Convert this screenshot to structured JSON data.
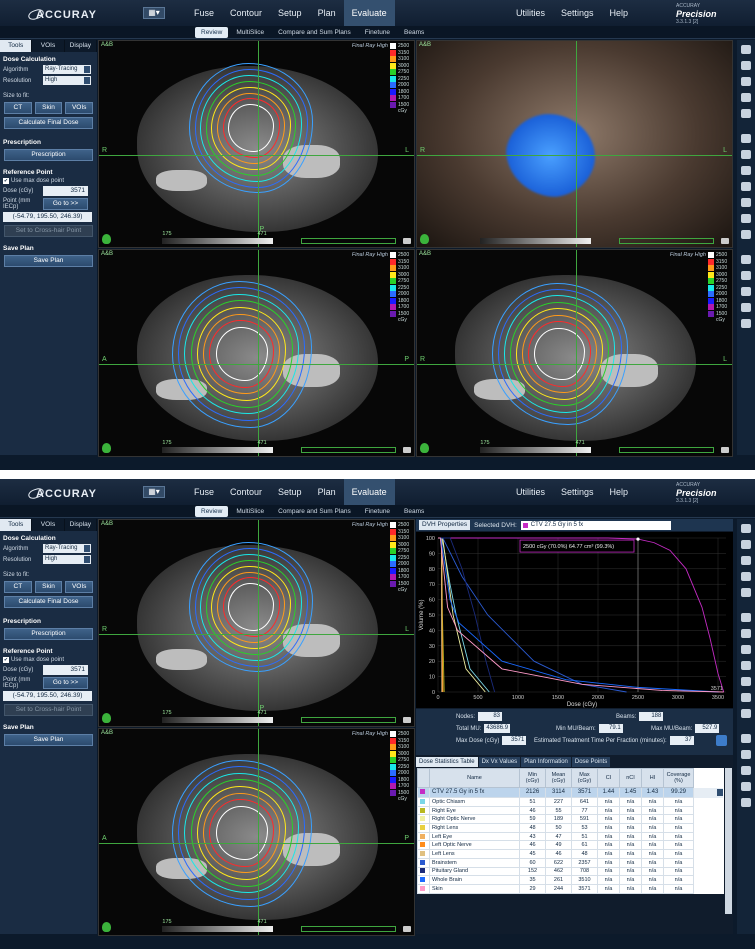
{
  "panels": [
    {
      "label": "A"
    },
    {
      "label": "B"
    }
  ],
  "app": {
    "logo": "ACCURAY",
    "brand_small": "ACCURAY",
    "brand": "Precision",
    "version": "3.3.1.3 [2]",
    "menu": [
      "Fuse",
      "Contour",
      "Setup",
      "Plan",
      "Evaluate"
    ],
    "menu_active": "Evaluate",
    "right_menu": [
      "Utilities",
      "Settings",
      "Help"
    ],
    "subtabs": [
      "Review",
      "MultiSlice",
      "Compare and Sum Plans",
      "Finetune",
      "Beams"
    ]
  },
  "sidebar": {
    "tabs": [
      "Tools",
      "VOIs",
      "Display"
    ],
    "dose_calculation": "Dose Calculation",
    "algorithm_label": "Algorithm",
    "algorithm_value": "Ray-Tracing",
    "resolution_label": "Resolution",
    "resolution_value": "High",
    "size_to_fit": "Size to fit:",
    "fit_buttons": [
      "CT",
      "Skin",
      "VOIs"
    ],
    "calc_final": "Calculate Final Dose",
    "prescription_header": "Prescription",
    "prescription_button": "Prescription",
    "reference_point": "Reference Point",
    "use_max": "Use max dose point",
    "dose_label": "Dose (cGy)",
    "dose_value": "3571",
    "point_label": "Point (mm IECp)",
    "goto": "Go to >>",
    "point_value": "(-54.79, 195.50, 246.39)",
    "crosshair": "Set to Cross-hair Point",
    "save_plan_header": "Save Plan",
    "save_plan_button": "Save Plan"
  },
  "viewport": {
    "corner": "A&B",
    "algorithm": "Final Ray High",
    "scale_values": [
      "2500",
      "3150",
      "3100",
      "3000",
      "2750",
      "2250",
      "2000",
      "1800",
      "1700",
      "1500"
    ],
    "scale_colors": [
      "#ffffff",
      "#ff2a2a",
      "#ff9a1a",
      "#ffe81a",
      "#2ad12a",
      "#1ae8e8",
      "#2a6cff",
      "#1a1aff",
      "#b01ab0",
      "#6a1ab0"
    ],
    "scale_unit": "cGy",
    "orient": {
      "R": "R",
      "L": "L",
      "A": "A",
      "P": "P"
    },
    "wl_low": "175",
    "wl_high": "471",
    "slice_num": "47",
    "slice_num2": "188",
    "slice_num3": "222"
  },
  "dvh": {
    "tab": "DVH Properties",
    "selected_label": "Selected DVH:",
    "selected_value": "CTV 27.5 Gy in 5 fx",
    "tooltip": "2500 cGy (70.0%) 64.77 cm³ (99.3%)",
    "ylabel": "Volume (%)",
    "xlabel": "Dose (cGy)",
    "xticks": [
      "0",
      "500",
      "1000",
      "1500",
      "2000",
      "2500",
      "3000",
      "3500"
    ],
    "yticks": [
      "100",
      "90",
      "80",
      "70",
      "60",
      "50",
      "40",
      "30",
      "20",
      "10",
      "0"
    ],
    "max_marker": "3571"
  },
  "chart_data": {
    "type": "line",
    "xlabel": "Dose (cGy)",
    "ylabel": "Volume (%)",
    "xlim": [
      0,
      3600
    ],
    "ylim": [
      0,
      100
    ],
    "series": [
      {
        "name": "CTV 27.5 Gy in 5 fx",
        "color": "#c42bc4",
        "x": [
          0,
          2126,
          2500,
          2700,
          2900,
          3100,
          3300,
          3400,
          3500,
          3571
        ],
        "y": [
          100,
          100,
          99.3,
          97,
          92,
          80,
          55,
          35,
          12,
          0
        ]
      },
      {
        "name": "Optic Chiasm",
        "color": "#7ad6e6",
        "x": [
          0,
          51,
          150,
          227,
          400,
          641
        ],
        "y": [
          100,
          100,
          70,
          50,
          15,
          0
        ]
      },
      {
        "name": "Right Eye",
        "color": "#b8b820",
        "x": [
          0,
          46,
          55,
          77
        ],
        "y": [
          100,
          100,
          50,
          0
        ]
      },
      {
        "name": "Right Optic Nerve",
        "color": "#f0f0a0",
        "x": [
          0,
          59,
          150,
          189,
          350,
          591
        ],
        "y": [
          100,
          100,
          65,
          50,
          15,
          0
        ]
      },
      {
        "name": "Right Lens",
        "color": "#e8d040",
        "x": [
          0,
          48,
          50,
          53
        ],
        "y": [
          100,
          100,
          50,
          0
        ]
      },
      {
        "name": "Left Eye",
        "color": "#f0b060",
        "x": [
          0,
          43,
          47,
          51
        ],
        "y": [
          100,
          100,
          50,
          0
        ]
      },
      {
        "name": "Left Optic Nerve",
        "color": "#ff8c1a",
        "x": [
          0,
          46,
          49,
          61
        ],
        "y": [
          100,
          100,
          50,
          0
        ]
      },
      {
        "name": "Left Lens",
        "color": "#e0c080",
        "x": [
          0,
          45,
          46,
          48
        ],
        "y": [
          100,
          100,
          50,
          0
        ]
      },
      {
        "name": "Brainstem",
        "color": "#2a5ad0",
        "x": [
          0,
          60,
          300,
          622,
          1200,
          1800,
          2357
        ],
        "y": [
          100,
          100,
          75,
          50,
          20,
          5,
          0
        ]
      },
      {
        "name": "Pituitary Gland",
        "color": "#1a2a7a",
        "x": [
          0,
          152,
          300,
          462,
          600,
          708
        ],
        "y": [
          100,
          100,
          80,
          50,
          20,
          0
        ]
      },
      {
        "name": "Whole Brain",
        "color": "#1a6aff",
        "x": [
          0,
          35,
          150,
          261,
          800,
          1600,
          2500,
          3510
        ],
        "y": [
          100,
          100,
          60,
          45,
          20,
          8,
          3,
          0
        ]
      },
      {
        "name": "Skin",
        "color": "#ff9ac8",
        "x": [
          0,
          29,
          120,
          244,
          800,
          1800,
          2800,
          3571
        ],
        "y": [
          100,
          100,
          55,
          40,
          15,
          5,
          1,
          0
        ]
      }
    ]
  },
  "stats": {
    "nodes_label": "Nodes:",
    "nodes": "83",
    "beams_label": "Beams:",
    "beams": "188",
    "total_mu_label": "Total MU:",
    "total_mu": "43686.9",
    "min_mu_label": "Min MU/Beam:",
    "min_mu": "79.1",
    "max_mu_label": "Max MU/Beam:",
    "max_mu": "527.9",
    "max_dose_label": "Max Dose (cGy)",
    "max_dose": "3571",
    "est_time_label": "Estimated Treatment Time Per Fraction (minutes):",
    "est_time": "37"
  },
  "dose_tabs": [
    "Dose Statistics Table",
    "Dx Vx Values",
    "Plan Information",
    "Dose Points"
  ],
  "dose_table": {
    "headers": [
      "Name",
      "Min (cGy)",
      "Mean (cGy)",
      "Max (cGy)",
      "CI",
      "nCI",
      "HI",
      "Coverage (%)"
    ],
    "rows": [
      {
        "color": "#c42bc4",
        "cells": [
          "CTV 27.5 Gy in 5 fx",
          "2126",
          "3114",
          "3571",
          "1.44",
          "1.45",
          "1.43",
          "99.29"
        ]
      },
      {
        "color": "#7ad6e6",
        "cells": [
          "Optic Chiasm",
          "51",
          "227",
          "641",
          "n/a",
          "n/a",
          "n/a",
          "n/a"
        ]
      },
      {
        "color": "#b8b820",
        "cells": [
          "Right Eye",
          "46",
          "55",
          "77",
          "n/a",
          "n/a",
          "n/a",
          "n/a"
        ]
      },
      {
        "color": "#f0f0a0",
        "cells": [
          "Right Optic Nerve",
          "59",
          "189",
          "591",
          "n/a",
          "n/a",
          "n/a",
          "n/a"
        ]
      },
      {
        "color": "#e8d040",
        "cells": [
          "Right Lens",
          "48",
          "50",
          "53",
          "n/a",
          "n/a",
          "n/a",
          "n/a"
        ]
      },
      {
        "color": "#f0b060",
        "cells": [
          "Left Eye",
          "43",
          "47",
          "51",
          "n/a",
          "n/a",
          "n/a",
          "n/a"
        ]
      },
      {
        "color": "#ff8c1a",
        "cells": [
          "Left Optic Nerve",
          "46",
          "49",
          "61",
          "n/a",
          "n/a",
          "n/a",
          "n/a"
        ]
      },
      {
        "color": "#e0c080",
        "cells": [
          "Left Lens",
          "45",
          "46",
          "48",
          "n/a",
          "n/a",
          "n/a",
          "n/a"
        ]
      },
      {
        "color": "#2a5ad0",
        "cells": [
          "Brainstem",
          "60",
          "622",
          "2357",
          "n/a",
          "n/a",
          "n/a",
          "n/a"
        ]
      },
      {
        "color": "#1a2a7a",
        "cells": [
          "Pituitary Gland",
          "152",
          "462",
          "708",
          "n/a",
          "n/a",
          "n/a",
          "n/a"
        ]
      },
      {
        "color": "#1a6aff",
        "cells": [
          "Whole Brain",
          "35",
          "261",
          "3510",
          "n/a",
          "n/a",
          "n/a",
          "n/a"
        ]
      },
      {
        "color": "#ff9ac8",
        "cells": [
          "Skin",
          "29",
          "244",
          "3571",
          "n/a",
          "n/a",
          "n/a",
          "n/a"
        ]
      }
    ]
  }
}
